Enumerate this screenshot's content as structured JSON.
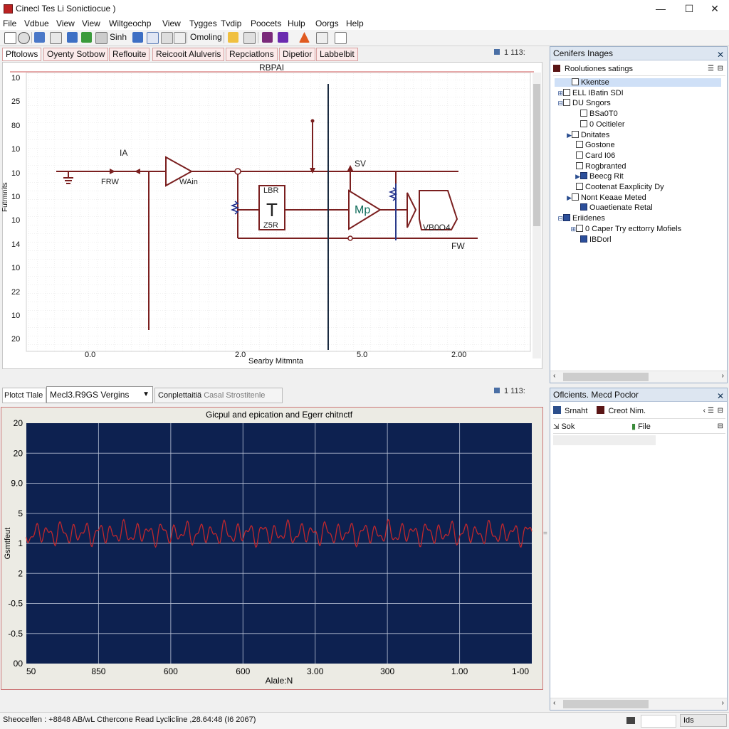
{
  "window": {
    "title": "Cinecl Tes Li Sonictiocue )",
    "minimize": "—",
    "maximize": "☐",
    "close": "✕"
  },
  "menu": [
    "File",
    "Vdbue",
    "View",
    "Wiltgeochp",
    "View",
    "Tygges",
    "Tvdip",
    "Poocets",
    "Hulp",
    "Oorgs",
    "Help"
  ],
  "toolbar": {
    "sinh_label": "Sinh",
    "omoling_label": "Omoling"
  },
  "schematic": {
    "tabs": [
      "Pftolows",
      "Oyenty Sotbow",
      "Reflouite",
      "Reicooit Alulveris",
      "Repciatlons",
      "Dipetior",
      "Labbelbit"
    ],
    "panel_info": "1 113:",
    "title": "RBPAI",
    "y_ticks": [
      "10",
      "25",
      "80",
      "10",
      "10",
      "10",
      "10",
      "14",
      "10",
      "22",
      "10",
      "20"
    ],
    "x_ticks": [
      "0.0",
      "2.0",
      "5.0",
      "2.00"
    ],
    "x_axis_label": "Searby Mitmnta",
    "y_axis_label": "Futrmnits",
    "labels": {
      "ia": "IA",
      "frw": "FRW",
      "wain": "WAin",
      "sv": "SV",
      "lbr": "LBR",
      "zsr": "Z5R",
      "mp": "Mp",
      "vboo": "VB0O4",
      "fw": "FW",
      "t": "T"
    }
  },
  "chart": {
    "tabs": {
      "plot_title_tab": "Plotct Tlale",
      "dropdown": "Mecl3.R9GS Vergins",
      "complete": "Conplettaitiä",
      "casal": "Casal Strostitenle"
    },
    "panel_info": "1 113:",
    "title": "Gicpul and epication and Egerr chitnctf",
    "xlabel": "Alale:N",
    "ylabel": "Gsmtfeut",
    "y_ticks": [
      "20",
      "20",
      "9.0",
      "5",
      "1",
      "2",
      "-0.5",
      "-0.5",
      "00"
    ],
    "x_ticks": [
      "50",
      "850",
      "600",
      "600",
      "3.00",
      "300",
      "1.00",
      "1-00"
    ],
    "colors": {
      "plot_bg": "#0d2150",
      "signal": "#c0272d",
      "grid": "#b9c2d6"
    }
  },
  "right_top": {
    "title": "Cenifers Inages",
    "header_item": "Roolutiones satings",
    "items": [
      {
        "label": "Kkentse",
        "kind": "box",
        "selected": true
      },
      {
        "label": "ELL IBatin SDI",
        "kind": "box"
      },
      {
        "label": "DU Sngors",
        "kind": "box"
      },
      {
        "label": "BSa0T0",
        "kind": "box"
      },
      {
        "label": "0 Ocitieler",
        "kind": "box"
      },
      {
        "label": "Dnitates",
        "kind": "box"
      },
      {
        "label": "Gostone",
        "kind": "box"
      },
      {
        "label": "Card I06",
        "kind": "box"
      },
      {
        "label": "Rogbranted",
        "kind": "box"
      },
      {
        "label": "Beecg Rit",
        "kind": "blue"
      },
      {
        "label": "Cootenat Eaxplicity Dy",
        "kind": "box"
      },
      {
        "label": "Nont Keaae Meted",
        "kind": "box"
      },
      {
        "label": "Ouaetienate Retal",
        "kind": "blue"
      },
      {
        "label": "Eriidenes",
        "kind": "blue"
      },
      {
        "label": "0 Caper Try ecttorry Mofiels",
        "kind": "box"
      },
      {
        "label": "IBDorl",
        "kind": "blue"
      }
    ]
  },
  "right_bottom": {
    "title": "Oflcients. Mecd Poclor",
    "search_label": "Srnaht",
    "create_label": "Creot Nim.",
    "col1": "Sok",
    "col2": "File"
  },
  "status": {
    "text": "Sheocelfen : +8848 AB/wL Cthercone Read Lyclicline ,28.64:48 (I6 2067)",
    "right": "Ids"
  }
}
